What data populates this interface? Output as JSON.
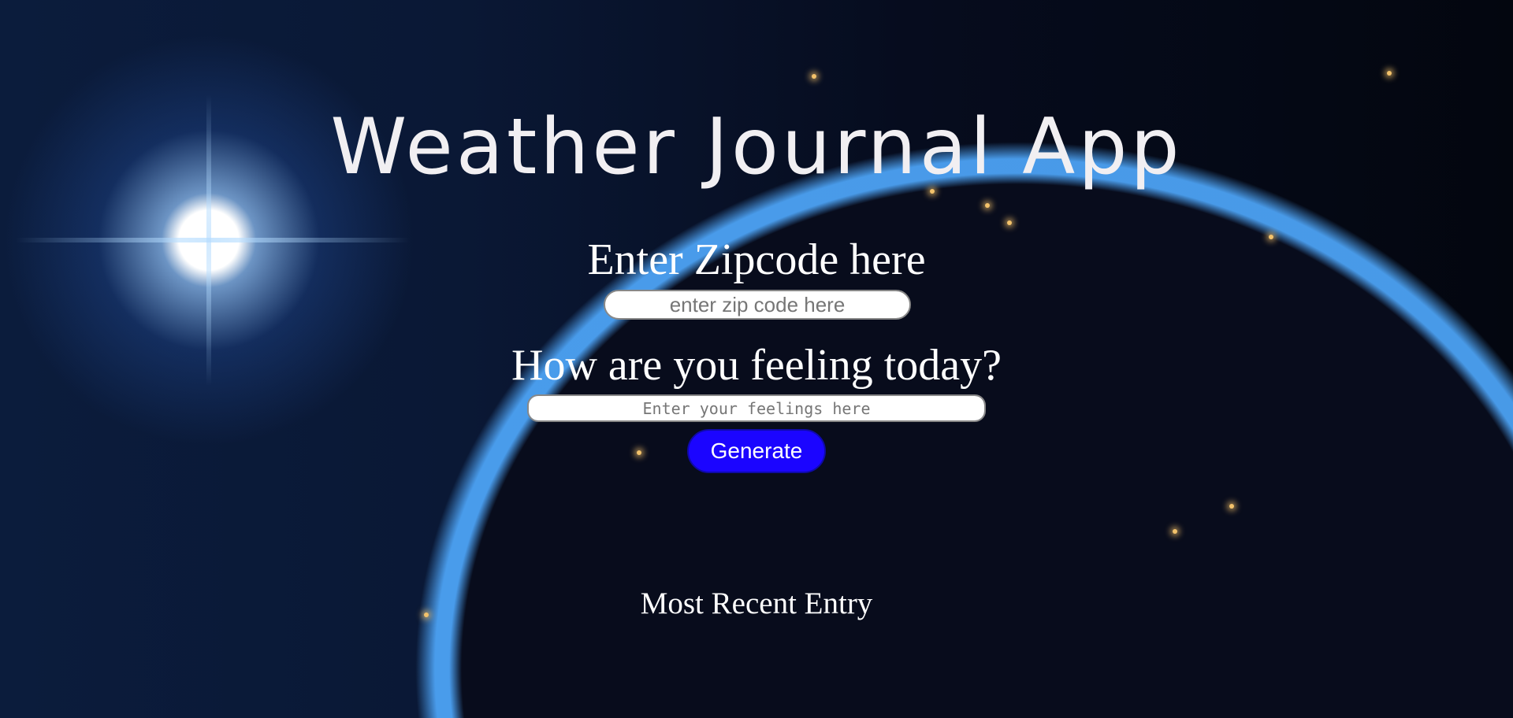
{
  "app": {
    "title": "Weather Journal App"
  },
  "zip": {
    "label": "Enter Zipcode here",
    "placeholder": "enter zip code here",
    "value": ""
  },
  "feelings": {
    "label": "How are you feeling today?",
    "placeholder": "Enter your feelings here",
    "value": ""
  },
  "actions": {
    "generate_label": "Generate"
  },
  "entry": {
    "title": "Most Recent Entry"
  },
  "theme": {
    "button_color": "#1b05ff",
    "text_color": "#ffffff",
    "title_color": "#f1eff2"
  },
  "background": {
    "subject": "earth-from-space-at-night"
  }
}
